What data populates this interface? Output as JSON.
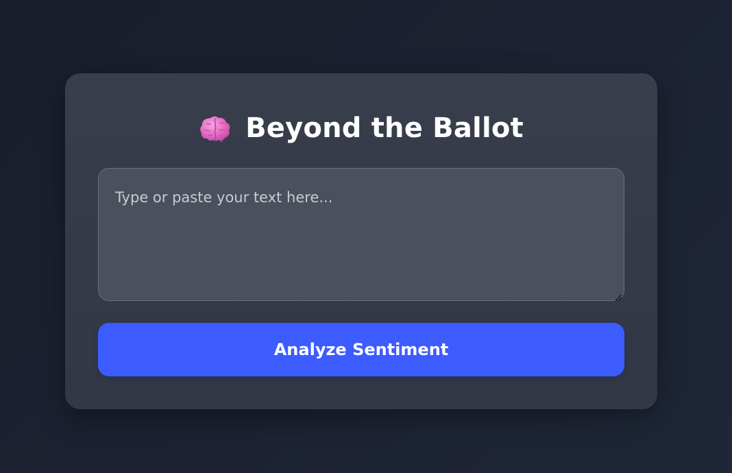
{
  "app": {
    "title": "Beyond the Ballot",
    "title_icon": "brain-icon"
  },
  "input": {
    "value": "",
    "placeholder": "Type or paste your text here..."
  },
  "actions": {
    "analyze_label": "Analyze Sentiment"
  },
  "colors": {
    "background": "#1c2232",
    "card": "#363c4a",
    "input_background": "#4a505c",
    "accent": "#3d5cff",
    "brain_pink": "#ec6fc8"
  }
}
